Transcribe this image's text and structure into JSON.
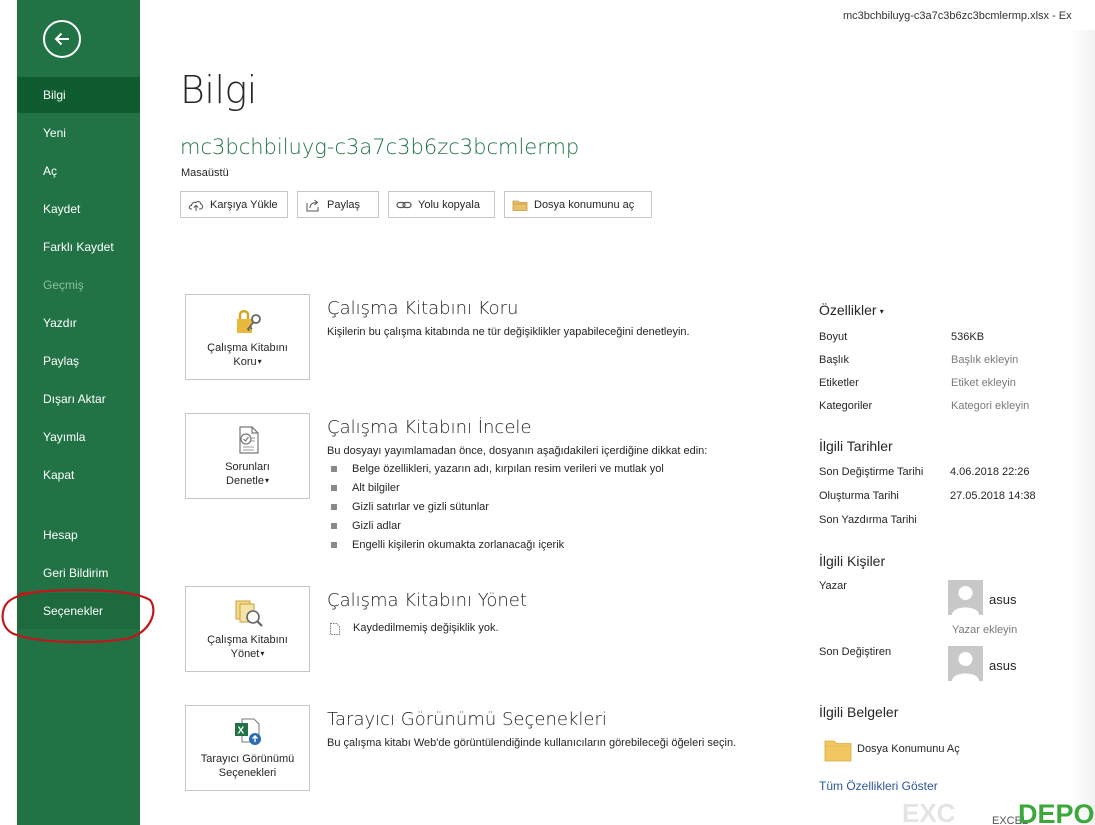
{
  "window": {
    "title": "mc3bchbiluyg-c3a7c3b6zc3bcmlermp.xlsx  -  Ex"
  },
  "sidebar": {
    "back_icon": "back-arrow-icon",
    "items": [
      {
        "label": "Bilgi",
        "state": "active"
      },
      {
        "label": "Yeni",
        "state": "normal"
      },
      {
        "label": "Aç",
        "state": "normal"
      },
      {
        "label": "Kaydet",
        "state": "normal"
      },
      {
        "label": "Farklı Kaydet",
        "state": "normal"
      },
      {
        "label": "Geçmiş",
        "state": "disabled"
      },
      {
        "label": "Yazdır",
        "state": "normal"
      },
      {
        "label": "Paylaş",
        "state": "normal"
      },
      {
        "label": "Dışarı Aktar",
        "state": "normal"
      },
      {
        "label": "Yayımla",
        "state": "normal"
      },
      {
        "label": "Kapat",
        "state": "normal"
      },
      {
        "label": "Hesap",
        "state": "normal"
      },
      {
        "label": "Geri Bildirim",
        "state": "normal"
      },
      {
        "label": "Seçenekler",
        "state": "highlighted"
      }
    ]
  },
  "main": {
    "title": "Bilgi",
    "file_name": "mc3bchbiluyg-c3a7c3b6zc3bcmlermp",
    "file_location": "Masaüstü",
    "actions": {
      "upload": "Karşıya Yükle",
      "share": "Paylaş",
      "copy_path": "Yolu kopyala",
      "open_location": "Dosya konumunu aç"
    },
    "sections": {
      "protect": {
        "tile_line1": "Çalışma Kitabını",
        "tile_line2": "Koru",
        "title": "Çalışma Kitabını Koru",
        "desc": "Kişilerin bu çalışma kitabında ne tür değişiklikler yapabileceğini denetleyin."
      },
      "inspect": {
        "tile_line1": "Sorunları",
        "tile_line2": "Denetle",
        "title": "Çalışma Kitabını İncele",
        "desc": "Bu dosyayı yayımlamadan önce, dosyanın aşağıdakileri içerdiğine dikkat edin:",
        "bullets": [
          "Belge özellikleri, yazarın adı, kırpılan resim verileri ve mutlak yol",
          "Alt bilgiler",
          "Gizli satırlar ve gizli sütunlar",
          "Gizli adlar",
          "Engelli kişilerin okumakta zorlanacağı içerik"
        ]
      },
      "manage": {
        "tile_line1": "Çalışma Kitabını",
        "tile_line2": "Yönet",
        "title": "Çalışma Kitabını Yönet",
        "desc": "Kaydedilmemiş değişiklik yok."
      },
      "browser": {
        "tile_line1": "Tarayıcı Görünümü",
        "tile_line2": "Seçenekleri",
        "title": "Tarayıcı Görünümü Seçenekleri",
        "desc": "Bu çalışma kitabı Web'de görüntülendiğinde kullanıcıların görebileceği öğeleri seçin."
      }
    }
  },
  "properties": {
    "heading": "Özellikler",
    "rows": [
      {
        "label": "Boyut",
        "value": "536KB",
        "muted": false
      },
      {
        "label": "Başlık",
        "value": "Başlık ekleyin",
        "muted": true
      },
      {
        "label": "Etiketler",
        "value": "Etiket ekleyin",
        "muted": true
      },
      {
        "label": "Kategoriler",
        "value": "Kategori ekleyin",
        "muted": true
      }
    ],
    "dates_heading": "İlgili Tarihler",
    "dates": [
      {
        "label": "Son Değiştirme Tarihi",
        "value": "4.06.2018 22:26"
      },
      {
        "label": "Oluşturma Tarihi",
        "value": "27.05.2018 14:38"
      },
      {
        "label": "Son Yazdırma Tarihi",
        "value": ""
      }
    ],
    "people_heading": "İlgili Kişiler",
    "author_label": "Yazar",
    "author_name": "asus",
    "add_author": "Yazar ekleyin",
    "last_modified_by_label": "Son Değiştiren",
    "last_modified_by_name": "asus",
    "docs_heading": "İlgili Belgeler",
    "open_location": "Dosya Konumunu Aç",
    "show_all": "Tüm Özellikleri Göster"
  },
  "colors": {
    "sidebar": "#217346",
    "sidebar_active": "#0e5c2f",
    "accent": "#217346",
    "link": "#2b579a",
    "annotation": "#c0171c"
  },
  "watermark": {
    "text": "EXCEL DEPO"
  }
}
